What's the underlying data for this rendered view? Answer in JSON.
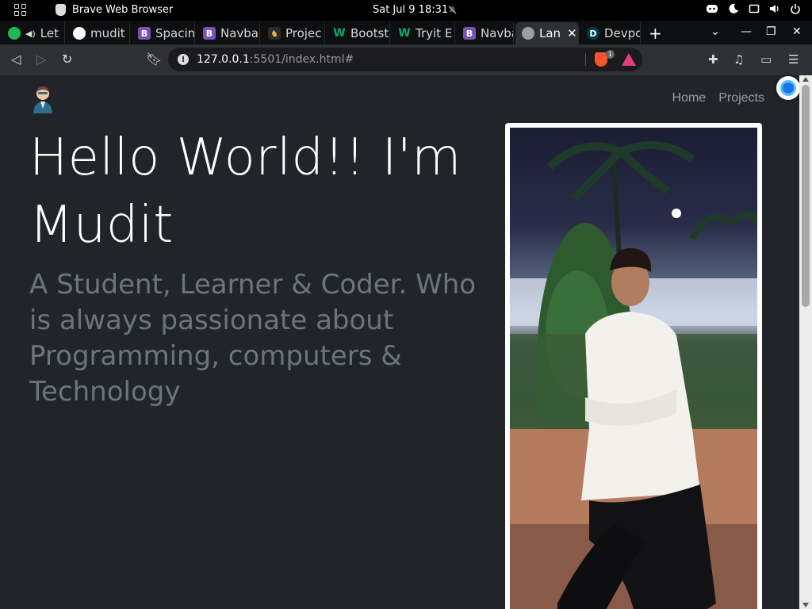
{
  "system": {
    "app_name": "Brave Web Browser",
    "clock": "Sat Jul 9  18:31"
  },
  "tabs": [
    {
      "label": "Let",
      "favicon": "spotify-icon",
      "color": "#1db954"
    },
    {
      "label": "mudit",
      "favicon": "github-icon",
      "color": "#ffffff"
    },
    {
      "label": "Spacin",
      "favicon": "bootstrap-icon",
      "color": "#7952b3"
    },
    {
      "label": "Navba",
      "favicon": "bootstrap-icon",
      "color": "#7952b3"
    },
    {
      "label": "Projec",
      "favicon": "project-icon",
      "color": "#f0c040"
    },
    {
      "label": "Bootst",
      "favicon": "w3schools-icon",
      "color": "#04aa6d"
    },
    {
      "label": "Tryit E",
      "favicon": "w3schools-icon",
      "color": "#04aa6d"
    },
    {
      "label": "Navba",
      "favicon": "bootstrap-icon",
      "color": "#7952b3"
    },
    {
      "label": "Lan",
      "favicon": "globe-icon",
      "color": "#9aa0a6"
    },
    {
      "label": "Devpo",
      "favicon": "devpost-icon",
      "color": "#003e54"
    }
  ],
  "address_bar": {
    "host": "127.0.0.1",
    "path": ":5501/index.html#",
    "shield_badge": "1"
  },
  "page": {
    "nav": {
      "home": "Home",
      "projects": "Projects"
    },
    "hero_title": "Hello World!! I'm Mudit",
    "lead": "A Student, Learner & Coder. Who is always passionate about Programming, computers & Technology"
  }
}
